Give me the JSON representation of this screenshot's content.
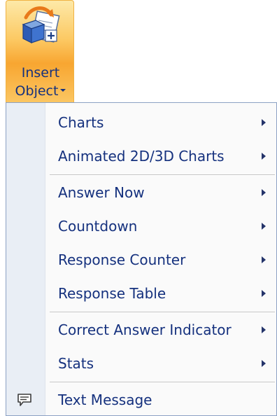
{
  "ribbon_button": {
    "label_line1": "Insert",
    "label_line2": "Object",
    "icon": "insert-object-icon"
  },
  "menu": {
    "items": [
      {
        "label": "Charts",
        "has_submenu": true
      },
      {
        "label": "Animated 2D/3D Charts",
        "has_submenu": true
      },
      {
        "label": "Answer Now",
        "has_submenu": true
      },
      {
        "label": "Countdown",
        "has_submenu": true
      },
      {
        "label": "Response Counter",
        "has_submenu": true
      },
      {
        "label": "Response Table",
        "has_submenu": true
      },
      {
        "label": "Correct Answer Indicator",
        "has_submenu": true
      },
      {
        "label": "Stats",
        "has_submenu": true
      },
      {
        "label": "Text Message",
        "has_submenu": false,
        "icon": "text-message-icon"
      }
    ]
  },
  "colors": {
    "accent_orange": "#f8a631",
    "text_blue": "#15317e",
    "menu_border": "#8ca1c4",
    "gutter": "#e9eef5"
  }
}
